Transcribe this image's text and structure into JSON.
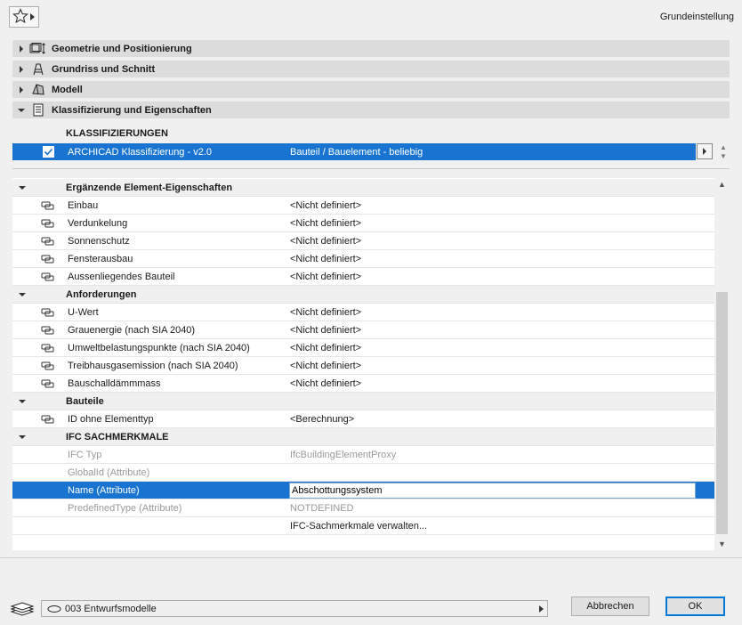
{
  "header": {
    "title": "Grundeinstellung"
  },
  "panels": [
    {
      "label": "Geometrie und Positionierung",
      "expanded": false,
      "icon": "geometry-icon"
    },
    {
      "label": "Grundriss und Schnitt",
      "expanded": false,
      "icon": "floorplan-section-icon"
    },
    {
      "label": "Modell",
      "expanded": false,
      "icon": "model-icon"
    },
    {
      "label": "Klassifizierung und Eigenschaften",
      "expanded": true,
      "icon": "classification-icon"
    }
  ],
  "classification": {
    "title": "KLASSIFIZIERUNGEN",
    "system": "ARCHICAD Klassifizierung - v2.0",
    "value": "Bauteil / Bauelement - beliebig",
    "checked": true
  },
  "groups": [
    {
      "label": "Ergänzende Element-Eigenschaften",
      "rows": [
        {
          "name": "Einbau",
          "value": "<Nicht definiert>"
        },
        {
          "name": "Verdunkelung",
          "value": "<Nicht definiert>"
        },
        {
          "name": "Sonnenschutz",
          "value": "<Nicht definiert>"
        },
        {
          "name": "Fensterausbau",
          "value": "<Nicht definiert>"
        },
        {
          "name": "Aussenliegendes Bauteil",
          "value": "<Nicht definiert>"
        }
      ]
    },
    {
      "label": "Anforderungen",
      "rows": [
        {
          "name": "U-Wert",
          "value": "<Nicht definiert>"
        },
        {
          "name": "Grauenergie (nach SIA 2040)",
          "value": "<Nicht definiert>"
        },
        {
          "name": "Umweltbelastungspunkte (nach SIA 2040)",
          "value": "<Nicht definiert>"
        },
        {
          "name": "Treibhausgasemission (nach SIA 2040)",
          "value": "<Nicht definiert>"
        },
        {
          "name": "Bauschalldämmmass",
          "value": "<Nicht definiert>"
        }
      ]
    },
    {
      "label": "Bauteile",
      "rows": [
        {
          "name": "ID ohne Elementtyp",
          "value": "<Berechnung>"
        }
      ]
    },
    {
      "label": "IFC SACHMERKMALE",
      "rows": [
        {
          "name": "IFC Typ",
          "value": "IfcBuildingElementProxy"
        },
        {
          "name": "GlobalId (Attribute)",
          "value": ""
        },
        {
          "name": "Name (Attribute)",
          "value": "Abschottungssystem"
        },
        {
          "name": "PredefinedType (Attribute)",
          "value": "NOTDEFINED"
        },
        {
          "name": "",
          "value": "IFC-Sachmerkmale verwalten..."
        }
      ]
    }
  ],
  "footer": {
    "layer": "003 Entwurfsmodelle",
    "cancel_label": "Abbrechen",
    "ok_label": "OK"
  },
  "colors": {
    "selection": "#1874d0",
    "group_bg": "#f0f0f0",
    "dim_text": "#9a9a9a"
  }
}
